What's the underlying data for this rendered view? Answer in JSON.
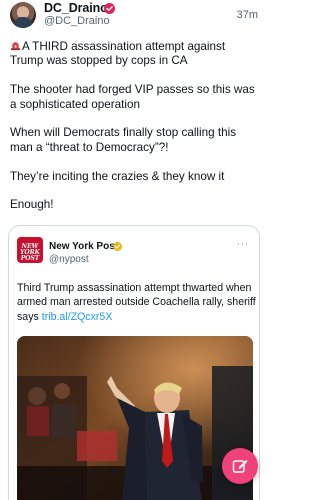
{
  "post": {
    "author": {
      "display_name": "DC_Draino",
      "handle": "@DC_Draino",
      "verified_color": "#e0245e"
    },
    "timestamp": "37m",
    "text": [
      "A THIRD assassination attempt against Trump was stopped by cops in CA",
      "The shooter had forged VIP passes so this was a sophisticated operation",
      "When will Democrats finally stop calling this man a “threat to Democracy”?!",
      "They’re inciting the crazies & they know it",
      "Enough!"
    ],
    "quoted": {
      "avatar_text": [
        "NEW",
        "YORK",
        "POST"
      ],
      "name": "New York Post",
      "handle": "@nypost",
      "more": "···",
      "text": "Third Trump assassination attempt thwarted when armed man arrested outside Coachella rally, sheriff says",
      "link": "trib.al/ZQcxr5X",
      "brand_color": "#c8102e",
      "verified_color": "#e2b719"
    }
  },
  "ui": {
    "accent_color": "#1d9bf0",
    "fab_color": "#f0427a",
    "fab_icon": "compose-icon"
  }
}
